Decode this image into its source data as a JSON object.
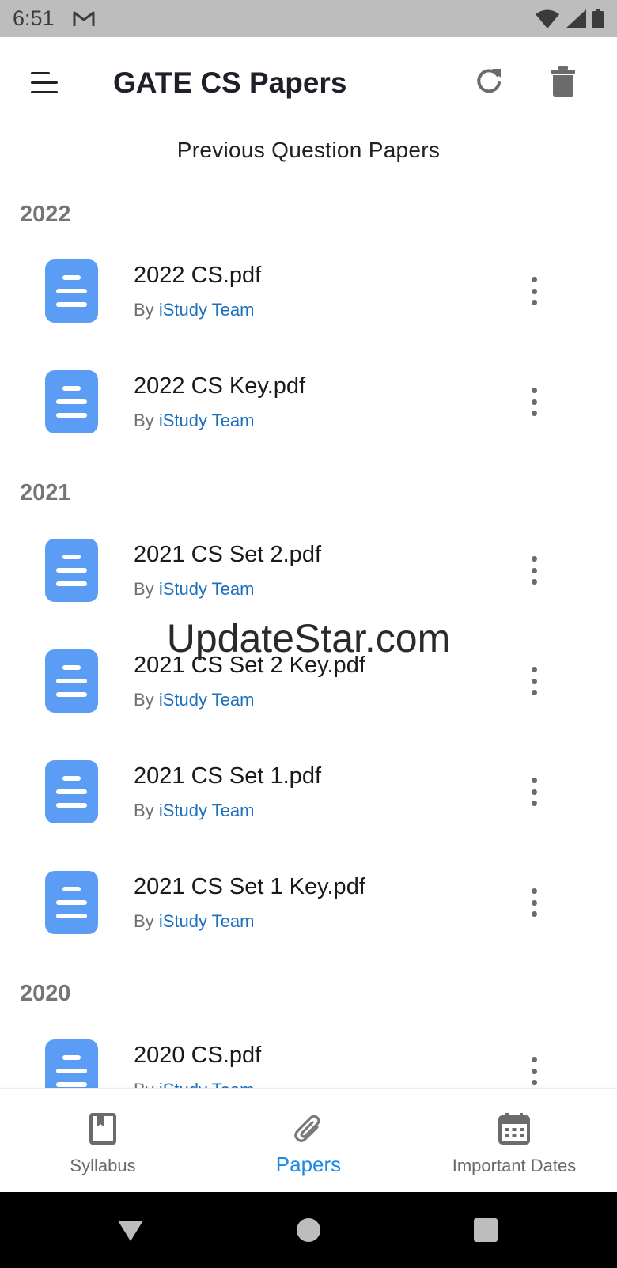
{
  "status_bar": {
    "time": "6:51"
  },
  "app_bar": {
    "title": "GATE CS Papers"
  },
  "subtitle": "Previous Question Papers",
  "sections": [
    {
      "year": "2022",
      "files": [
        {
          "name": "2022 CS.pdf",
          "by": "By",
          "author": "iStudy Team"
        },
        {
          "name": "2022 CS Key.pdf",
          "by": "By",
          "author": "iStudy Team"
        }
      ]
    },
    {
      "year": "2021",
      "files": [
        {
          "name": "2021 CS Set 2.pdf",
          "by": "By",
          "author": "iStudy Team"
        },
        {
          "name": "2021 CS Set 2 Key.pdf",
          "by": "By",
          "author": "iStudy Team"
        },
        {
          "name": "2021 CS Set 1.pdf",
          "by": "By",
          "author": "iStudy Team"
        },
        {
          "name": "2021 CS Set 1 Key.pdf",
          "by": "By",
          "author": "iStudy Team"
        }
      ]
    },
    {
      "year": "2020",
      "files": [
        {
          "name": "2020 CS.pdf",
          "by": "By",
          "author": "iStudy Team"
        }
      ]
    }
  ],
  "watermark": "UpdateStar.com",
  "bottom_nav": {
    "items": [
      {
        "label": "Syllabus",
        "icon": "book-icon",
        "active": false
      },
      {
        "label": "Papers",
        "icon": "paperclip-icon",
        "active": true
      },
      {
        "label": "Important Dates",
        "icon": "calendar-icon",
        "active": false
      }
    ]
  },
  "colors": {
    "accent": "#1e88e5",
    "file_icon": "#5b9cf5",
    "author_link": "#1a6fbf",
    "status_bar": "#bdbdbd"
  }
}
